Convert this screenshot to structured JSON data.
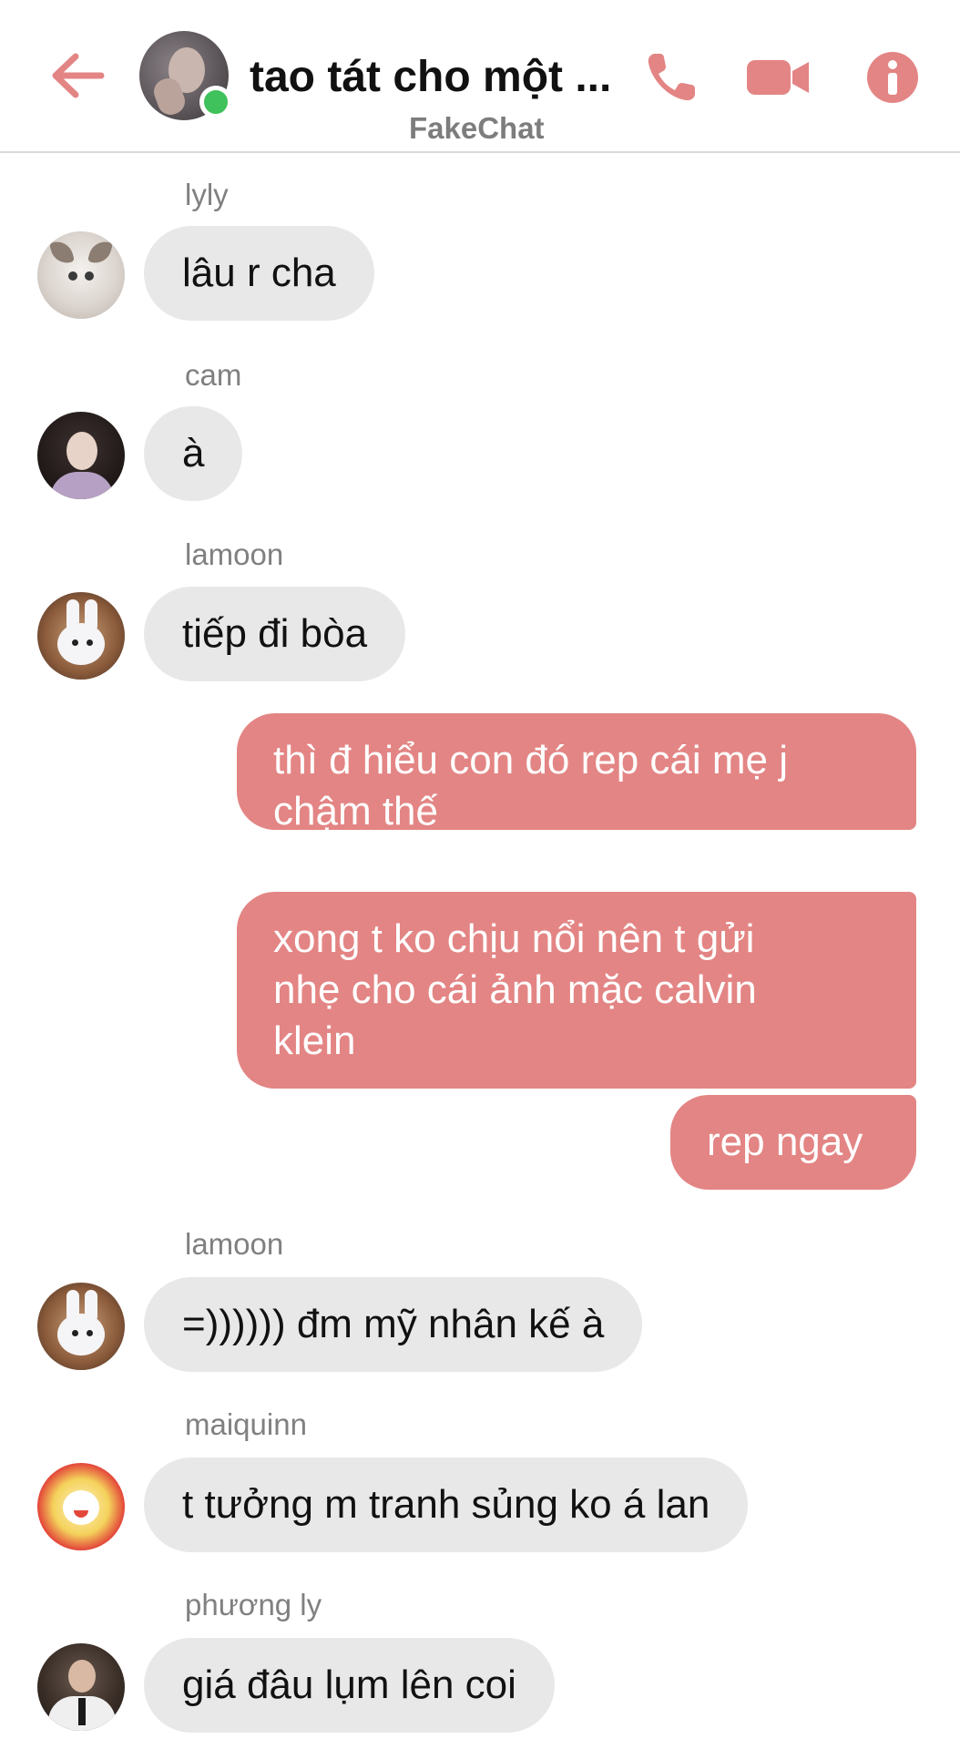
{
  "header": {
    "title": "tao tát cho một ...",
    "subtitle": "FakeChat",
    "online": true,
    "accent_color": "#e38584",
    "icons": {
      "back": "arrow-left-icon",
      "call": "phone-icon",
      "video": "video-camera-icon",
      "info": "info-icon"
    }
  },
  "messages": [
    {
      "type": "incoming",
      "sender": "lyly",
      "text": "lâu r cha",
      "avatar": "cat-avatar"
    },
    {
      "type": "incoming",
      "sender": "cam",
      "text": "à",
      "avatar": "girl-avatar"
    },
    {
      "type": "incoming",
      "sender": "lamoon",
      "text": "tiếp đi bòa",
      "avatar": "bunny-avatar"
    },
    {
      "type": "outgoing",
      "lines": [
        "thì đ hiểu con đó rep cái mẹ j",
        "chậm thế"
      ]
    },
    {
      "type": "outgoing",
      "lines": [
        "xong t ko chịu nổi nên t gửi",
        "nhẹ cho cái ảnh mặc calvin",
        "klein"
      ]
    },
    {
      "type": "outgoing",
      "lines": [
        "rep ngay"
      ]
    },
    {
      "type": "incoming",
      "sender": "lamoon",
      "text": "=)))))) đm mỹ nhân kế à",
      "avatar": "bunny-avatar"
    },
    {
      "type": "incoming",
      "sender": "maiquinn",
      "text": "t tưởng m tranh sủng ko á lan",
      "avatar": "sticker-avatar"
    },
    {
      "type": "incoming",
      "sender": "phương ly",
      "text": "giá đâu lụm lên coi",
      "avatar": "photo-avatar"
    }
  ],
  "colors": {
    "outgoing_bubble": "#e38584",
    "incoming_bubble": "#e8e8e8",
    "online_dot": "#3fc15b"
  }
}
